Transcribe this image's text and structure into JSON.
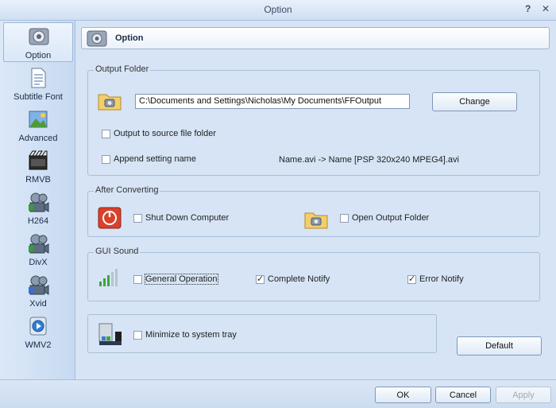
{
  "window": {
    "title": "Option",
    "help_glyph": "?",
    "close_glyph": "✕"
  },
  "sidebar": {
    "items": [
      {
        "label": "Option",
        "icon": "option-icon"
      },
      {
        "label": "Subtitle Font",
        "icon": "subtitle-font-icon"
      },
      {
        "label": "Advanced",
        "icon": "advanced-icon"
      },
      {
        "label": "RMVB",
        "icon": "rmvb-icon"
      },
      {
        "label": "H264",
        "icon": "h264-icon"
      },
      {
        "label": "DivX",
        "icon": "divx-icon"
      },
      {
        "label": "Xvid",
        "icon": "xvid-icon"
      },
      {
        "label": "WMV2",
        "icon": "wmv2-icon"
      }
    ]
  },
  "header": {
    "title": "Option"
  },
  "output_folder": {
    "legend": "Output Folder",
    "path_value": "C:\\Documents and Settings\\Nicholas\\My Documents\\FFOutput",
    "change_label": "Change",
    "output_to_source": {
      "label": "Output to source file folder",
      "checked": false
    },
    "append_setting": {
      "label": "Append setting name",
      "checked": false
    },
    "example_text": "Name.avi  -> Name [PSP 320x240 MPEG4].avi"
  },
  "after_converting": {
    "legend": "After Converting",
    "shutdown": {
      "label": "Shut Down Computer",
      "checked": false
    },
    "open_folder": {
      "label": "Open Output Folder",
      "checked": false
    }
  },
  "gui_sound": {
    "legend": "GUI Sound",
    "general": {
      "label": "General Operation",
      "checked": false
    },
    "complete": {
      "label": "Complete Notify",
      "checked": true
    },
    "error": {
      "label": "Error Notify",
      "checked": true
    }
  },
  "tray": {
    "label": "Minimize to system tray",
    "checked": false
  },
  "buttons": {
    "default": "Default",
    "ok": "OK",
    "cancel": "Cancel",
    "apply": "Apply"
  },
  "colors": {
    "accent": "#9bb5d5",
    "background": "#d6e4f5",
    "shutdown_red": "#d9412b"
  }
}
